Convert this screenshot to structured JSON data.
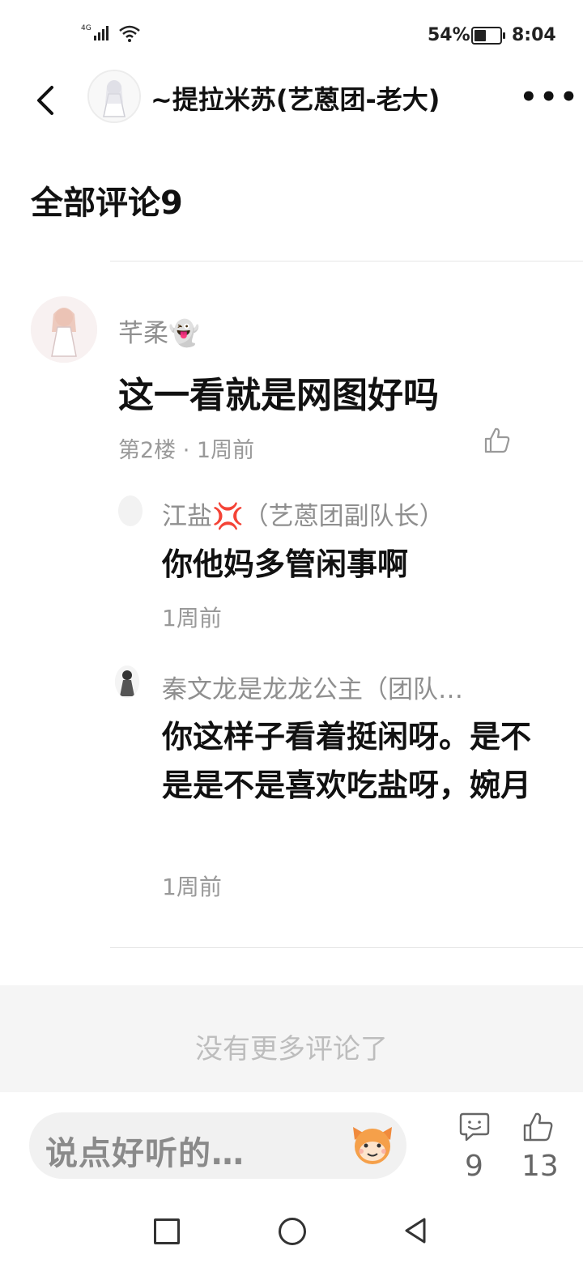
{
  "status_bar": {
    "network": "4G",
    "battery": "54%",
    "time": "8:04"
  },
  "header": {
    "title": "~提拉米苏(艺蒽团-老大)",
    "more": "•••"
  },
  "section": {
    "title": "全部评论9"
  },
  "comment": {
    "author": "芊柔👻",
    "text": "这一看就是网图好吗",
    "meta": "第2楼 · 1周前",
    "replies": [
      {
        "author": "江盐💢（艺蒽团副队长）",
        "text": "你他妈多管闲事啊",
        "time": "1周前"
      },
      {
        "author": "秦文龙是龙龙公主（团队…",
        "text": "你这样子看着挺闲呀。是不是是不是喜欢吃盐呀，婉月",
        "time": "1周前"
      }
    ]
  },
  "footer": {
    "no_more": "没有更多评论了"
  },
  "bottom_bar": {
    "input_placeholder": "说点好听的…",
    "comment_count": "9",
    "like_count": "13"
  },
  "colors": {
    "text_primary": "#111111",
    "text_secondary": "#8f8f8f",
    "band": "#f5f5f5"
  }
}
